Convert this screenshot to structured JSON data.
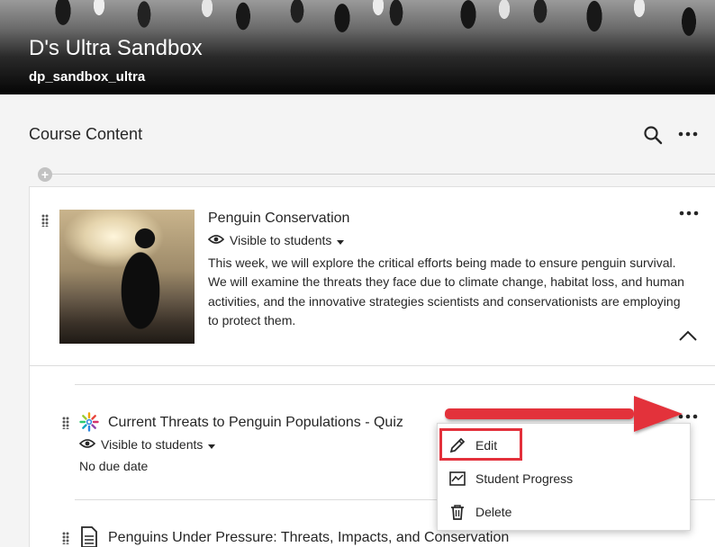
{
  "banner": {
    "course_title": "D's Ultra Sandbox",
    "course_id": "dp_sandbox_ultra"
  },
  "content": {
    "heading": "Course Content",
    "search_icon": "search-icon",
    "more_icon": "more-options-icon",
    "add_icon": "plus-icon"
  },
  "folder": {
    "title": "Penguin Conservation",
    "visibility": "Visible to students",
    "description": "This week, we will explore the critical efforts being made to ensure penguin survival. We will examine the threats they face due to climate change, habitat loss, and human activities, and the innovative strategies scientists and conservationists are employing to protect them.",
    "collapse_icon": "chevron-up-icon"
  },
  "items": [
    {
      "title": "Current Threats to Penguin Populations - Quiz",
      "visibility": "Visible to students",
      "due": "No due date",
      "icon": "quiz-icon"
    },
    {
      "title": "Penguins Under Pressure: Threats, Impacts, and Conservation",
      "icon": "document-icon"
    }
  ],
  "menu": {
    "edit": "Edit",
    "progress": "Student Progress",
    "delete": "Delete"
  },
  "colors": {
    "highlight": "#e3303b",
    "arrow": "#e3303b"
  }
}
